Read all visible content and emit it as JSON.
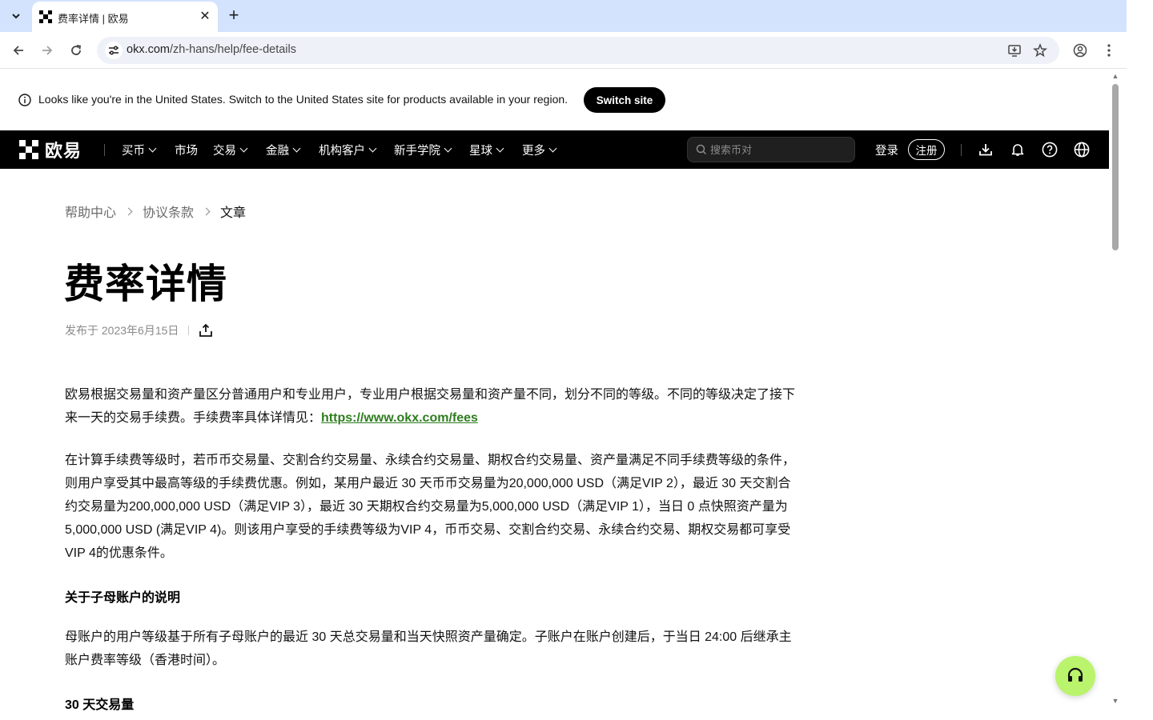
{
  "browser": {
    "tab_title": "费率详情 | 欧易",
    "url_host": "okx.com",
    "url_path": "/zh-hans/help/fee-details"
  },
  "banner": {
    "text": "Looks like you're in the United States. Switch to the United States site for products available in your region.",
    "button": "Switch site"
  },
  "nav": {
    "logo_text": "欧易",
    "items": [
      {
        "label": "买币",
        "has_dropdown": true
      },
      {
        "label": "市场",
        "has_dropdown": false
      },
      {
        "label": "交易",
        "has_dropdown": true
      },
      {
        "label": "金融",
        "has_dropdown": true
      },
      {
        "label": "机构客户",
        "has_dropdown": true
      },
      {
        "label": "新手学院",
        "has_dropdown": true
      },
      {
        "label": "星球",
        "has_dropdown": true
      },
      {
        "label": "更多",
        "has_dropdown": true
      }
    ],
    "search_placeholder": "搜索币对",
    "login": "登录",
    "register": "注册",
    "icons": [
      "download-icon",
      "bell-icon",
      "help-icon",
      "globe-icon"
    ]
  },
  "article": {
    "breadcrumb": [
      "帮助中心",
      "协议条款",
      "文章"
    ],
    "title": "费率详情",
    "published": "发布于 2023年6月15日",
    "p1_text": "欧易根据交易量和资产量区分普通用户和专业用户，专业用户根据交易量和资产量不同，划分不同的等级。不同的等级决定了接下来一天的交易手续费。手续费率具体详情见：",
    "p1_link": "https://www.okx.com/fees",
    "p2_line1": "在计算手续费等级时，若币币交易量、交割合约交易量、永续合约交易量、期权合约交易量、资产量满足不同手续费等级的条件，",
    "p2_line2": "则用户享受其中最高等级的手续费优惠。例如，某用户最近 30 天币币交易量为20,000,000 USD（满足VIP 2），最近 30 天交割合",
    "p2_line3": "约交易量为200,000,000 USD（满足VIP 3），最近 30 天期权合约交易量为5,000,000 USD（满足VIP 1），当日 0 点快照资产量为",
    "p2_line4": "5,000,000 USD (满足VIP 4)。则该用户享受的手续费等级为VIP 4，币币交易、交割合约交易、永续合约交易、期权交易都可享受",
    "p2_line5": "VIP 4的优惠条件。",
    "h1": "关于子母账户的说明",
    "p3_line1": "母账户的用户等级基于所有子母账户的最近 30 天总交易量和当天快照资产量确定。子账户在账户创建后，于当日 24:00 后继承主",
    "p3_line2": "账户费率等级（香港时间）。",
    "h2": "30 天交易量"
  },
  "colors": {
    "nav_bg": "#000000",
    "link": "#2e7d1f",
    "fab": "#b9f46c",
    "chrome_tabstrip": "#d3e3fd"
  }
}
